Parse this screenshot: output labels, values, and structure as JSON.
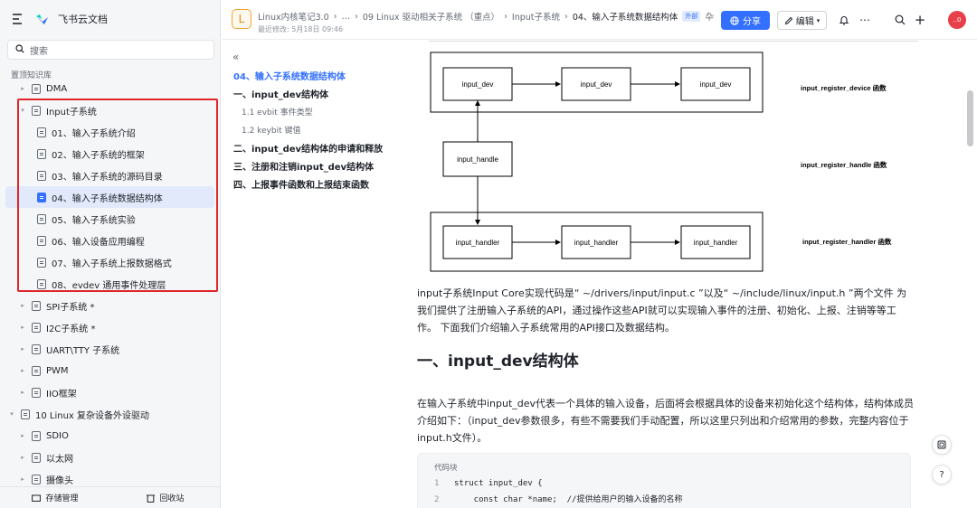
{
  "sidebar": {
    "brand": "飞书云文档",
    "search_placeholder": "搜索",
    "kb_label": "置顶知识库",
    "items": [
      {
        "label": "DMA",
        "indent": 1,
        "arrow": "▸"
      },
      {
        "label": "Input子系统",
        "indent": 1,
        "arrow": "▾"
      },
      {
        "label": "01、输入子系统介绍",
        "indent": 2,
        "arrow": ""
      },
      {
        "label": "02、输入子系统的框架",
        "indent": 2,
        "arrow": ""
      },
      {
        "label": "03、输入子系统的源码目录",
        "indent": 2,
        "arrow": ""
      },
      {
        "label": "04、输入子系统数据结构体",
        "indent": 2,
        "arrow": "",
        "active": true
      },
      {
        "label": "05、输入子系统实验",
        "indent": 2,
        "arrow": ""
      },
      {
        "label": "06、输入设备应用编程",
        "indent": 2,
        "arrow": ""
      },
      {
        "label": "07、输入子系统上报数据格式",
        "indent": 2,
        "arrow": ""
      },
      {
        "label": "08、evdev 通用事件处理层",
        "indent": 2,
        "arrow": ""
      },
      {
        "label": "SPI子系统 *",
        "indent": 1,
        "arrow": "▸"
      },
      {
        "label": "I2C子系统 *",
        "indent": 1,
        "arrow": "▸"
      },
      {
        "label": "UART\\TTY 子系统",
        "indent": 1,
        "arrow": "▸"
      },
      {
        "label": "PWM",
        "indent": 1,
        "arrow": "▸"
      },
      {
        "label": "IIO框架",
        "indent": 1,
        "arrow": "▸"
      },
      {
        "label": "10 Linux 复杂设备外设驱动",
        "indent": 0,
        "arrow": "▾"
      },
      {
        "label": "SDIO",
        "indent": 1,
        "arrow": "▸"
      },
      {
        "label": "以太网",
        "indent": 1,
        "arrow": "▸"
      },
      {
        "label": "摄像头",
        "indent": 1,
        "arrow": "▸"
      }
    ],
    "footer": {
      "storage": "存储管理",
      "trash": "回收站"
    }
  },
  "header": {
    "badge": "L",
    "crumbs": [
      "Linux内核笔记3.0",
      "…",
      "09 Linux 驱动相关子系统 （重点）",
      "Input子系统",
      "04、输入子系统数据结构体"
    ],
    "ext_tag": "外部",
    "more_hint": "卆",
    "modified": "最近修改: 5月18日 09:46",
    "share": "分享",
    "edit": "编辑",
    "avatar": "..0"
  },
  "toc": {
    "items": [
      {
        "label": "04、输入子系统数据结构体",
        "level": 1,
        "current": true
      },
      {
        "label": "一、input_dev结构体",
        "level": 1
      },
      {
        "label": "1.1 evbit 事件类型",
        "level": 2
      },
      {
        "label": "1.2 keybit 键值",
        "level": 2
      },
      {
        "label": "二、input_dev结构体的申请和释放",
        "level": 1
      },
      {
        "label": "三、注册和注销input_dev结构体",
        "level": 1
      },
      {
        "label": "四、上报事件函数和上报结束函数",
        "level": 1
      }
    ]
  },
  "diagram": {
    "row1_boxes": [
      "input_dev",
      "input_dev",
      "input_dev"
    ],
    "row1_label": "input_register_device 函数",
    "handle_box": "input_handle",
    "handle_label": "input_register_handle 函数",
    "row3_boxes": [
      "input_handler",
      "input_handler",
      "input_handler"
    ],
    "row3_label": "input_register_handler 函数"
  },
  "content": {
    "para1": "input子系统Input Core实现代码是“ ~/drivers/input/input.c ”以及“ ~/include/linux/input.h ”两个文件 为我们提供了注册输入子系统的API，通过操作这些API就可以实现输入事件的注册、初始化、上报、注销等等工作。 下面我们介绍输入子系统常用的API接口及数据结构。",
    "h1": "一、input_dev结构体",
    "para2": "在输入子系统中input_dev代表一个具体的输入设备，后面将会根据具体的设备来初始化这个结构体，结构体成员介绍如下：（input_dev参数很多，有些不需要我们手动配置，所以这里只列出和介绍常用的参数，完整内容位于input.h文件）。",
    "code_title": "代码块",
    "code_lines": [
      {
        "n": "1",
        "text": "struct input_dev {"
      },
      {
        "n": "2",
        "text": "    const char *name;  //提供给用户的输入设备的名称"
      }
    ]
  }
}
